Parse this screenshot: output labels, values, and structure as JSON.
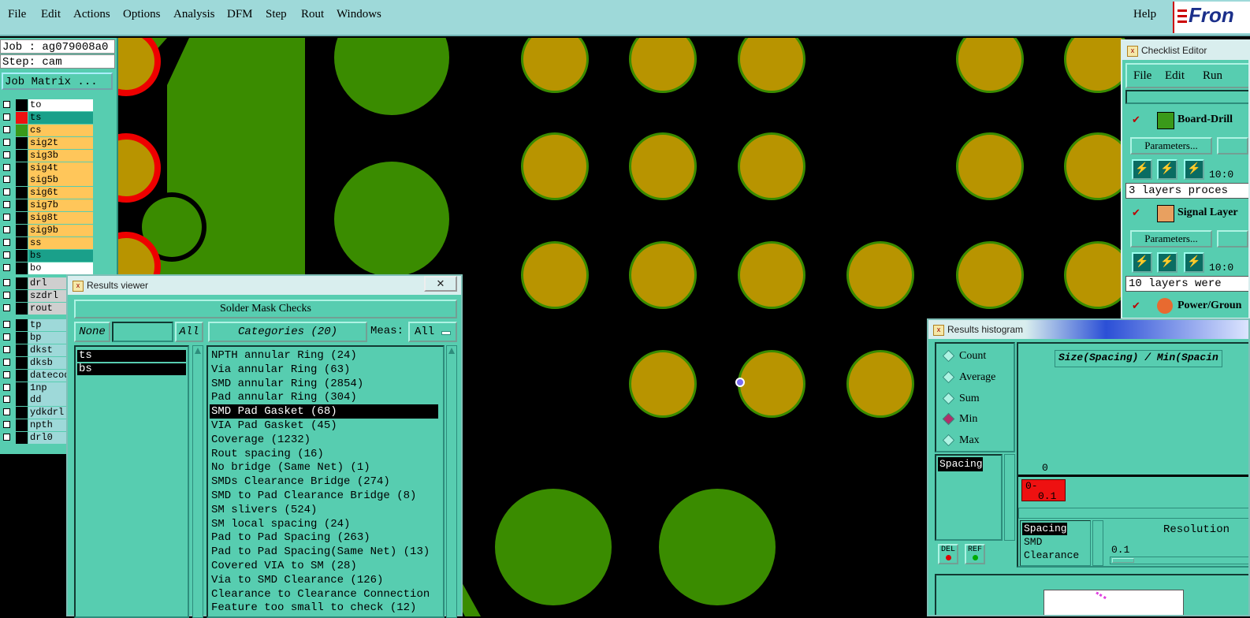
{
  "menubar": {
    "items": [
      "File",
      "Edit",
      "Actions",
      "Options",
      "Analysis",
      "DFM",
      "Step",
      "Rout",
      "Windows"
    ],
    "help": "Help",
    "logo": "Fron"
  },
  "left_panel": {
    "job": "Job : ag079008a0",
    "step": "Step: cam",
    "job_matrix": "Job Matrix ...",
    "layers_board": [
      {
        "name": "to",
        "color": "#ffffff",
        "swatch": "#000000"
      },
      {
        "name": "ts",
        "color": "#1aa08a",
        "swatch": "#ee1111"
      },
      {
        "name": "cs",
        "color": "#ffc65a",
        "swatch": "#3a9a1a"
      },
      {
        "name": "sig2t",
        "color": "#ffc65a",
        "swatch": "#000000"
      },
      {
        "name": "sig3b",
        "color": "#ffc65a",
        "swatch": "#000000"
      },
      {
        "name": "sig4t",
        "color": "#ffc65a",
        "swatch": "#000000"
      },
      {
        "name": "sig5b",
        "color": "#ffc65a",
        "swatch": "#000000"
      },
      {
        "name": "sig6t",
        "color": "#ffc65a",
        "swatch": "#000000"
      },
      {
        "name": "sig7b",
        "color": "#ffc65a",
        "swatch": "#000000"
      },
      {
        "name": "sig8t",
        "color": "#ffc65a",
        "swatch": "#000000"
      },
      {
        "name": "sig9b",
        "color": "#ffc65a",
        "swatch": "#000000"
      },
      {
        "name": "ss",
        "color": "#ffc65a",
        "swatch": "#000000"
      },
      {
        "name": "bs",
        "color": "#1aa08a",
        "swatch": "#000000"
      },
      {
        "name": "bo",
        "color": "#ffffff",
        "swatch": "#000000"
      }
    ],
    "layers_drill": [
      {
        "name": "drl",
        "color": "#cfcfcf",
        "swatch": "#000000"
      },
      {
        "name": "szdrl",
        "color": "#cfcfcf",
        "swatch": "#000000"
      },
      {
        "name": "rout",
        "color": "#cfcfcf",
        "swatch": "#000000"
      }
    ],
    "layers_misc": [
      {
        "name": "tp",
        "color": "#9ed9d9",
        "swatch": "#000000"
      },
      {
        "name": "bp",
        "color": "#9ed9d9",
        "swatch": "#000000"
      },
      {
        "name": "dkst",
        "color": "#9ed9d9",
        "swatch": "#000000"
      },
      {
        "name": "dksb",
        "color": "#9ed9d9",
        "swatch": "#000000"
      },
      {
        "name": "datecod",
        "color": "#9ed9d9",
        "swatch": "#000000"
      },
      {
        "name": "1np",
        "color": "#9ed9d9",
        "swatch": "#000000"
      },
      {
        "name": "dd",
        "color": "#9ed9d9",
        "swatch": "#000000"
      },
      {
        "name": "ydkdrl",
        "color": "#9ed9d9",
        "swatch": "#000000"
      },
      {
        "name": "npth",
        "color": "#9ed9d9",
        "swatch": "#000000"
      },
      {
        "name": "drl0",
        "color": "#9ed9d9",
        "swatch": "#000000"
      }
    ]
  },
  "results_viewer": {
    "title": "Results viewer",
    "close": "✕",
    "heading": "Solder Mask Checks",
    "none_btn": "None",
    "all_btn": "All",
    "categories_btn": "Categories (20)",
    "meas_label": "Meas:",
    "meas_value": "All",
    "layers": [
      "ts",
      "bs"
    ],
    "categories": [
      "NPTH annular Ring (24)",
      "Via annular Ring (63)",
      "SMD annular Ring (2854)",
      "Pad annular Ring (304)",
      "SMD Pad Gasket (68)",
      "VIA Pad Gasket (45)",
      "Coverage (1232)",
      "Rout spacing (16)",
      "No bridge (Same Net) (1)",
      "SMDs Clearance Bridge (274)",
      "SMD to Pad Clearance Bridge (8)",
      "SM slivers (524)",
      "SM local spacing (24)",
      "Pad to Pad Spacing (263)",
      "Pad to Pad Spacing(Same Net) (13)",
      "Covered VIA to SM (28)",
      "Via to SMD Clearance (126)",
      "Clearance to Clearance Connection",
      "Feature too small to check (12)"
    ],
    "selected_index": 4
  },
  "checklist_editor": {
    "title": "Checklist Editor",
    "menu": [
      "File",
      "Edit",
      "Run"
    ],
    "items": [
      {
        "name": "Board-Drill",
        "params": "Parameters...",
        "time": "10:0",
        "status": "3 layers proces"
      },
      {
        "name": "Signal Layer",
        "params": "Parameters...",
        "time": "10:0",
        "status": "10 layers were"
      },
      {
        "name": "Power/Groun"
      }
    ]
  },
  "histogram": {
    "title": "Results histogram",
    "modes": [
      "Count",
      "Average",
      "Sum",
      "Min",
      "Max"
    ],
    "selected_mode": "Min",
    "chart_title": "Size(Spacing) / Min(Spacin",
    "axis_zero": "0",
    "bin_label_1": "0-",
    "bin_label_2": "0.1",
    "list_left": [
      "Spacing"
    ],
    "del_btn": "DEL",
    "ref_btn": "REF",
    "list_bottom": [
      "Spacing",
      "SMD",
      "Clearance"
    ],
    "resolution_label": "Resolution",
    "resolution_value": "0.1"
  }
}
